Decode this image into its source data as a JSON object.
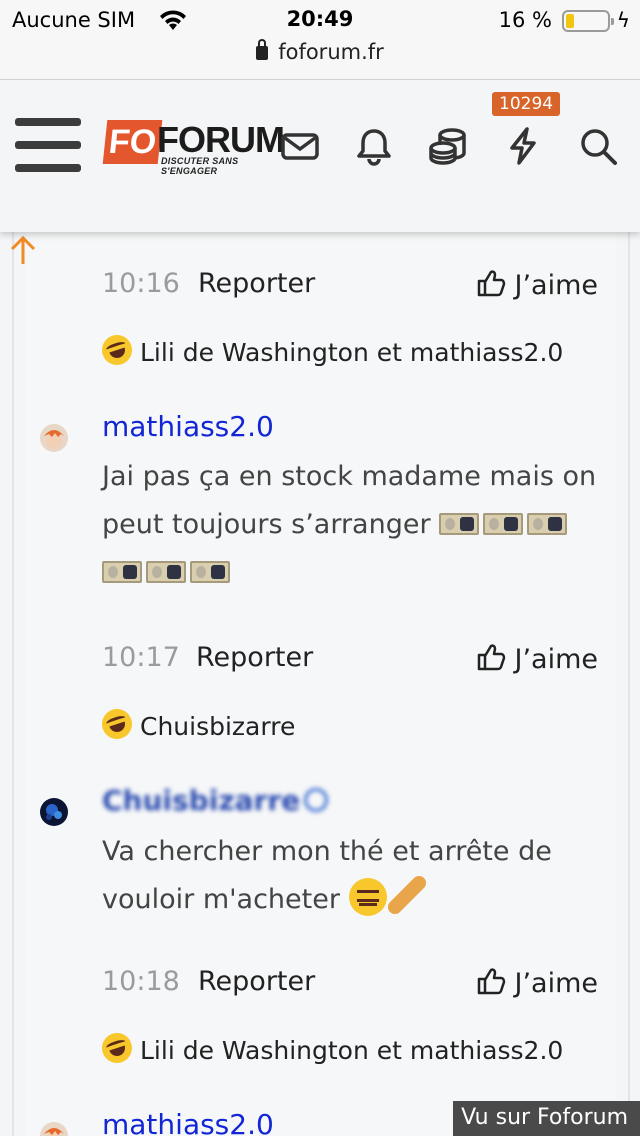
{
  "status_bar": {
    "carrier": "Aucune SIM",
    "time": "20:49",
    "battery_pct": "16 %",
    "url": "foforum.fr"
  },
  "header": {
    "logo_fo": "FO",
    "logo_forum": "FORUM",
    "logo_tagline": "DISCUTER SANS S'ENGAGER",
    "notification_count": "10294",
    "icons": [
      "menu-icon",
      "mail-icon",
      "bell-icon",
      "coins-icon",
      "bolt-icon",
      "search-icon"
    ],
    "accent": "#e4572e",
    "badge_color": "#d9642a"
  },
  "thread": {
    "blocks": [
      {
        "time": "10:16",
        "report": "Reporter",
        "like": "J’aime",
        "reactions": "Lili de Washington et mathiass2.0"
      },
      {
        "author": "mathiass2.0",
        "message": "Jai pas ça en stock madame mais on peut toujours s’arranger",
        "time": "10:17",
        "report": "Reporter",
        "like": "J’aime",
        "reactions": "Chuisbizarre"
      },
      {
        "author": "Chuisbizarre",
        "message": "Va chercher mon thé et arrête de vouloir m'acheter",
        "time": "10:18",
        "report": "Reporter",
        "like": "J’aime",
        "reactions": "Lili de Washington et mathiass2.0"
      },
      {
        "author": "mathiass2.0"
      }
    ],
    "author_color": "#1326d6"
  },
  "watermark": "Vu sur Foforum"
}
